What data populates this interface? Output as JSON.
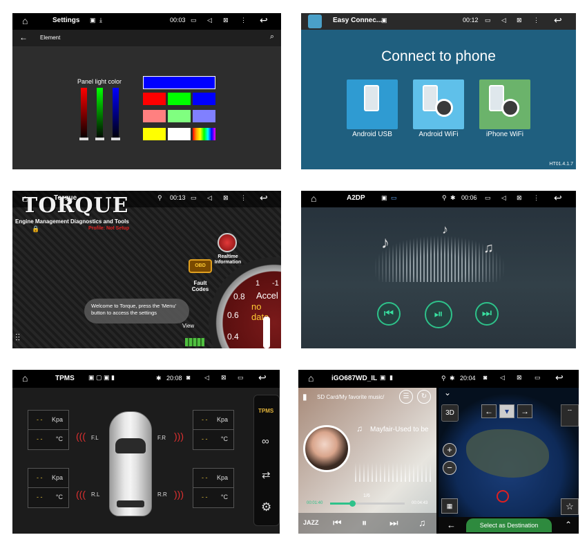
{
  "p1": {
    "title": "Settings",
    "time": "00:03",
    "sub": "Element",
    "label": "Panel light color",
    "colors": {
      "row1": [
        "#0000ff"
      ],
      "row2": [
        "#ff0000",
        "#00ff00",
        "#0000ff"
      ],
      "row3": [
        "#ff8080",
        "#80ff80",
        "#8080ff"
      ],
      "row4": [
        "#ffff00",
        "#ffffff",
        "rainbow"
      ]
    }
  },
  "p2": {
    "title": "Easy Connec...",
    "time": "00:12",
    "heading": "Connect to phone",
    "cards": [
      "Android USB",
      "Android WiFi",
      "iPhone WiFi"
    ],
    "version": "HT01.4.1.7"
  },
  "p3": {
    "title": "Torque",
    "time": "00:13",
    "logo": "TORQUE",
    "tagline": "Engine Management Diagnostics and Tools",
    "profile": "Profile: Not Setup",
    "realtime": "Realtime Information",
    "fault": "Fault Codes",
    "view": "View",
    "toast": "Welcome to Torque, press the 'Menu' button to access the settings",
    "gauge": {
      "t1": "1",
      "t2": "-1",
      "v1": "0.8",
      "v2": "0.6",
      "v3": "0.4",
      "label": "Accel",
      "nodata": "no data"
    }
  },
  "p4": {
    "title": "A2DP",
    "time": "00:06"
  },
  "p5": {
    "title": "TPMS",
    "time": "20:08",
    "side": "TPMS",
    "fl": "F.L",
    "fr": "F.R",
    "rl": "R.L",
    "rr": "R.R",
    "dash": "- -",
    "kpa": "Kpa",
    "deg": "°C"
  },
  "p6": {
    "title": "iGO687WD_IL",
    "time": "20:04",
    "path": "SD Card/My favorite music/",
    "song": "Mayfair-Used to be",
    "count": "1/6",
    "elapsed": "00:01:40",
    "total": "00:04:43",
    "eq": "JAZZ",
    "d3": "3D",
    "dest": "Select as Destination",
    "mini": "--",
    "progress": 0.3
  }
}
